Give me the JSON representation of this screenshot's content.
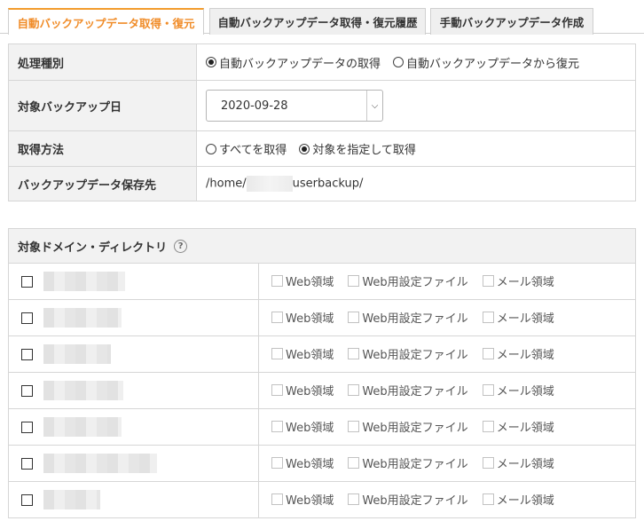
{
  "tabs": [
    {
      "label": "自動バックアップデータ取得・復元",
      "active": true
    },
    {
      "label": "自動バックアップデータ取得・復元履歴",
      "active": false
    },
    {
      "label": "手動バックアップデータ作成",
      "active": false
    }
  ],
  "form": {
    "process_type": {
      "label": "処理種別",
      "options": [
        "自動バックアップデータの取得",
        "自動バックアップデータから復元"
      ],
      "selected": 0
    },
    "backup_date": {
      "label": "対象バックアップ日",
      "value": "2020-09-28"
    },
    "method": {
      "label": "取得方法",
      "options": [
        "すべてを取得",
        "対象を指定して取得"
      ],
      "selected": 1
    },
    "save_path": {
      "label": "バックアップデータ保存先",
      "prefix": "/home/",
      "suffix": "userbackup/"
    }
  },
  "domains_section": {
    "title": "対象ドメイン・ディレクトリ",
    "help": "?",
    "option_labels": [
      "Web領域",
      "Web用設定ファイル",
      "メール領域"
    ],
    "rows": 7
  },
  "colors": {
    "accent": "#f08c28",
    "header_bg": "#f2f2f2",
    "border": "#d6d6d6"
  }
}
